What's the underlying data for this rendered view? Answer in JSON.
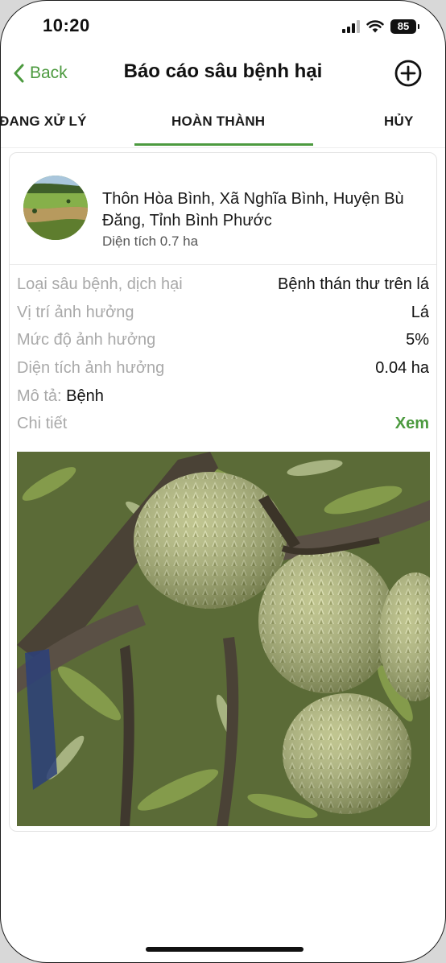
{
  "status_bar": {
    "time": "10:20",
    "battery": "85"
  },
  "nav": {
    "back_label": "Back",
    "title": "Báo cáo sâu bệnh hại",
    "back_icon": "chevron-left-icon",
    "add_icon": "plus-circle-icon"
  },
  "tabs": [
    {
      "label": "ĐANG XỬ LÝ",
      "active": false
    },
    {
      "label": "HOÀN THÀNH",
      "active": true
    },
    {
      "label": "HỦY",
      "active": false
    }
  ],
  "report": {
    "address": "Thôn Hòa Bình, Xã Nghĩa Bình, Huyện Bù Đăng, Tỉnh Bình Phước",
    "area": "Diện tích 0.7 ha",
    "rows": [
      {
        "label": "Loại sâu bệnh, dịch hại",
        "value": "Bệnh thán thư trên lá"
      },
      {
        "label": "Vị trí ảnh hưởng",
        "value": "Lá"
      },
      {
        "label": "Mức độ ảnh hưởng",
        "value": "5%"
      },
      {
        "label": "Diện tích ảnh hưởng",
        "value": "0.04 ha"
      }
    ],
    "description_label": "Mô tả:",
    "description_value": "Bệnh",
    "detail_label": "Chi tiết",
    "detail_link": "Xem"
  },
  "colors": {
    "accent": "#4c9a3f",
    "text": "#111111",
    "muted": "#a9a9a9"
  }
}
